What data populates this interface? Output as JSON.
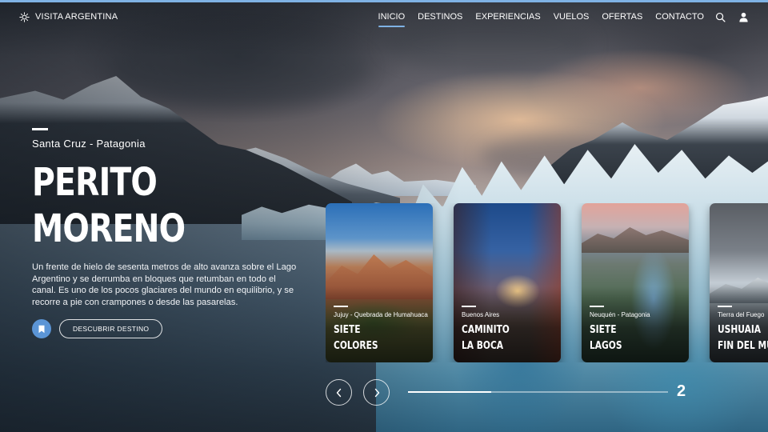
{
  "brand": {
    "name": "VISITA ARGENTINA",
    "logo_icon": "sun-icon"
  },
  "nav": {
    "items": [
      {
        "label": "INICIO",
        "active": true
      },
      {
        "label": "DESTINOS",
        "active": false
      },
      {
        "label": "EXPERIENCIAS",
        "active": false
      },
      {
        "label": "VUELOS",
        "active": false
      },
      {
        "label": "OFERTAS",
        "active": false
      },
      {
        "label": "CONTACTO",
        "active": false
      }
    ],
    "icons": [
      "search-icon",
      "user-icon"
    ]
  },
  "hero": {
    "location": "Santa Cruz - Patagonia",
    "title_line1": "PERITO",
    "title_line2": "MORENO",
    "description": "Un frente de hielo de sesenta metros de alto avanza sobre el Lago Argentino y se derrumba en bloques que retumban en todo el canal. Es uno de los pocos glaciares del mundo en equilibrio, y se recorre a pie con crampones o desde las pasarelas.",
    "discover_label": "DESCUBRIR DESTINO",
    "bookmark_icon": "bookmark-icon"
  },
  "cards": [
    {
      "subtitle": "Jujuy - Quebrada de Humahuaca",
      "title_line1": "SIETE",
      "title_line2": "COLORES"
    },
    {
      "subtitle": "Buenos Aires",
      "title_line1": "CAMINITO",
      "title_line2": "LA BOCA"
    },
    {
      "subtitle": "Neuquén - Patagonia",
      "title_line1": "SIETE",
      "title_line2": "LAGOS"
    },
    {
      "subtitle": "Tierra del Fuego",
      "title_line1": "USHUAIA",
      "title_line2": "FIN DEL MUNDO"
    }
  ],
  "slider": {
    "current_slide": "2",
    "progress": 0.32,
    "prev_icon": "chevron-left-icon",
    "next_icon": "chevron-right-icon"
  },
  "colors": {
    "accent": "#7fb2e4",
    "bookmark": "#5b95d6"
  }
}
